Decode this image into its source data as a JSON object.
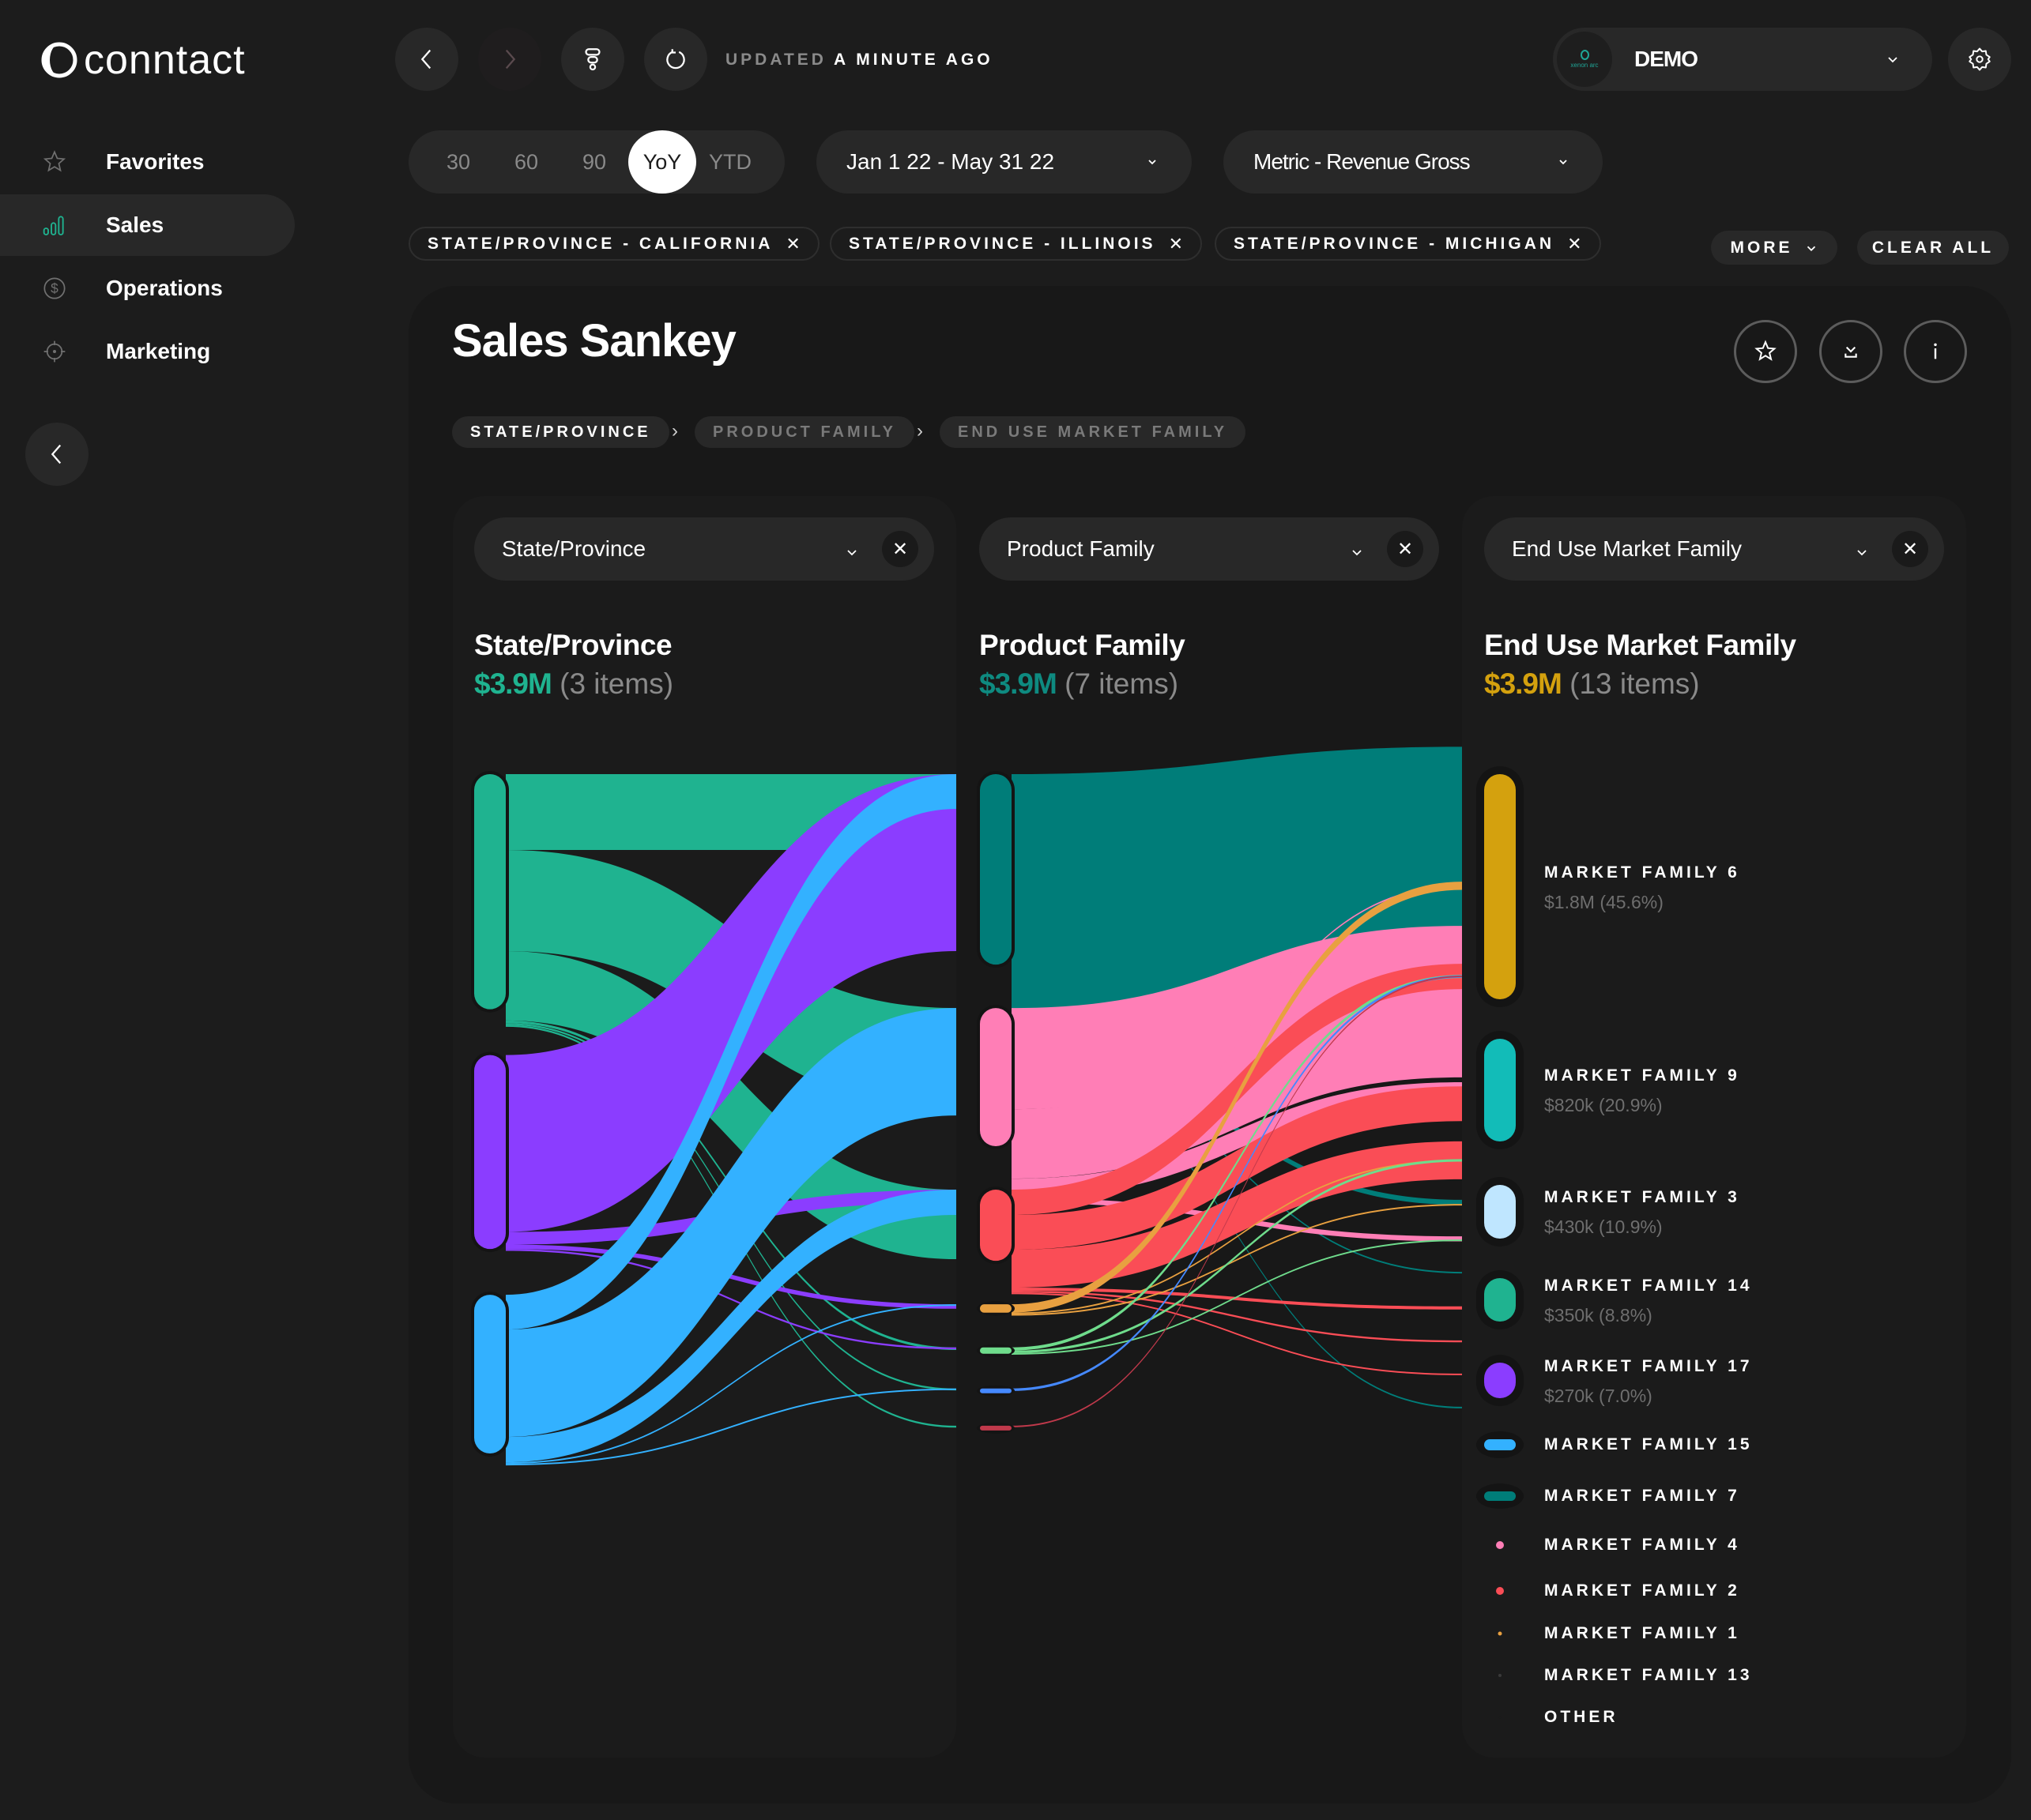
{
  "app": {
    "logo_text": "conntact",
    "updated_prefix": "UPDATED",
    "updated_suffix": "A MINUTE AGO",
    "workspace": {
      "label": "DEMO",
      "brand": "xenon arc"
    }
  },
  "sidebar": {
    "items": [
      {
        "label": "Favorites",
        "icon": "star-icon",
        "active": false
      },
      {
        "label": "Sales",
        "icon": "bar-chart-icon",
        "active": true
      },
      {
        "label": "Operations",
        "icon": "dollar-icon",
        "active": false
      },
      {
        "label": "Marketing",
        "icon": "target-icon",
        "active": false
      }
    ]
  },
  "filters": {
    "periods": [
      "30",
      "60",
      "90",
      "YoY",
      "YTD"
    ],
    "active_period": "YoY",
    "date_range": "Jan 1 22 - May 31 22",
    "metric": "Metric - Revenue Gross",
    "chips": [
      "STATE/PROVINCE - CALIFORNIA",
      "STATE/PROVINCE - ILLINOIS",
      "STATE/PROVINCE - MICHIGAN"
    ],
    "more_label": "MORE",
    "clear_label": "CLEAR ALL"
  },
  "card": {
    "title": "Sales Sankey",
    "breadcrumb": [
      "STATE/PROVINCE",
      "PRODUCT FAMILY",
      "END USE MARKET FAMILY"
    ],
    "columns": [
      {
        "selector": "State/Province",
        "heading": "State/Province",
        "total": "$3.9M",
        "count": "(3 items)",
        "accent": "#1fb390"
      },
      {
        "selector": "Product Family",
        "heading": "Product Family",
        "total": "$3.9M",
        "count": "(7 items)",
        "accent": "#0e8a80"
      },
      {
        "selector": "End Use Market Family",
        "heading": "End Use Market Family",
        "total": "$3.9M",
        "count": "(13 items)",
        "accent": "#d4a10e"
      }
    ]
  },
  "legend": [
    {
      "name": "MARKET FAMILY 6",
      "value": "$1.8M (45.6%)",
      "color": "#d4a10e"
    },
    {
      "name": "MARKET FAMILY 9",
      "value": "$820k (20.9%)",
      "color": "#12bcb8"
    },
    {
      "name": "MARKET FAMILY 3",
      "value": "$430k (10.9%)",
      "color": "#bfe6ff"
    },
    {
      "name": "MARKET FAMILY 14",
      "value": "$350k (8.8%)",
      "color": "#1fb390"
    },
    {
      "name": "MARKET FAMILY 17",
      "value": "$270k (7.0%)",
      "color": "#8b3dff"
    },
    {
      "name": "MARKET FAMILY 15",
      "value": "",
      "color": "#33b1ff"
    },
    {
      "name": "MARKET FAMILY 7",
      "value": "",
      "color": "#007d79"
    },
    {
      "name": "MARKET FAMILY 4",
      "value": "",
      "color": "#ff7eb6"
    },
    {
      "name": "MARKET FAMILY 2",
      "value": "",
      "color": "#fa4d56"
    },
    {
      "name": "MARKET FAMILY 1",
      "value": "",
      "color": "#e8a040"
    },
    {
      "name": "MARKET FAMILY 13",
      "value": "",
      "color": "#3a3a3a"
    },
    {
      "name": "OTHER",
      "value": "",
      "color": "#1b1b1b"
    }
  ],
  "chart_data": {
    "type": "sankey",
    "title": "Sales Sankey",
    "units": "USD",
    "total": 3900000,
    "stages": [
      "State/Province",
      "Product Family",
      "End Use Market Family"
    ],
    "nodes": {
      "state": [
        {
          "id": "s1",
          "share": 0.4,
          "color": "#1fb390"
        },
        {
          "id": "s2",
          "share": 0.33,
          "color": "#8b3dff"
        },
        {
          "id": "s3",
          "share": 0.27,
          "color": "#33b1ff"
        }
      ],
      "product": [
        {
          "id": "p1",
          "share": 0.455,
          "color": "#007d79"
        },
        {
          "id": "p2",
          "share": 0.33,
          "color": "#ff7eb6"
        },
        {
          "id": "p3",
          "share": 0.17,
          "color": "#fa4d56"
        },
        {
          "id": "p4",
          "share": 0.02,
          "color": "#e8a040"
        },
        {
          "id": "p5",
          "share": 0.015,
          "color": "#6fdc8c"
        },
        {
          "id": "p6",
          "share": 0.006,
          "color": "#4589ff"
        },
        {
          "id": "p7",
          "share": 0.004,
          "color": "#c0394b"
        }
      ],
      "market": [
        {
          "id": "MARKET FAMILY 6",
          "share": 0.456
        },
        {
          "id": "MARKET FAMILY 9",
          "share": 0.209
        },
        {
          "id": "MARKET FAMILY 3",
          "share": 0.109
        },
        {
          "id": "MARKET FAMILY 14",
          "share": 0.088
        },
        {
          "id": "MARKET FAMILY 17",
          "share": 0.07
        },
        {
          "id": "MARKET FAMILY 15",
          "share": 0.02
        },
        {
          "id": "MARKET FAMILY 7",
          "share": 0.016
        },
        {
          "id": "MARKET FAMILY 4",
          "share": 0.012
        },
        {
          "id": "MARKET FAMILY 2",
          "share": 0.01
        },
        {
          "id": "MARKET FAMILY 1",
          "share": 0.005
        },
        {
          "id": "MARKET FAMILY 13",
          "share": 0.003
        },
        {
          "id": "OTHER",
          "share": 0.002
        }
      ]
    },
    "links_stage1": [
      {
        "source": "s1",
        "target": "p1",
        "share": 0.12
      },
      {
        "source": "s1",
        "target": "p2",
        "share": 0.16
      },
      {
        "source": "s1",
        "target": "p3",
        "share": 0.11
      },
      {
        "source": "s1",
        "target": "p5",
        "share": 0.004
      },
      {
        "source": "s1",
        "target": "p6",
        "share": 0.003
      },
      {
        "source": "s1",
        "target": "p7",
        "share": 0.003
      },
      {
        "source": "s2",
        "target": "p1",
        "share": 0.28
      },
      {
        "source": "s2",
        "target": "p3",
        "share": 0.02
      },
      {
        "source": "s2",
        "target": "p4",
        "share": 0.007
      },
      {
        "source": "s2",
        "target": "p5",
        "share": 0.003
      },
      {
        "source": "s3",
        "target": "p1",
        "share": 0.055
      },
      {
        "source": "s3",
        "target": "p2",
        "share": 0.17
      },
      {
        "source": "s3",
        "target": "p3",
        "share": 0.04
      },
      {
        "source": "s3",
        "target": "p4",
        "share": 0.002
      },
      {
        "source": "s3",
        "target": "p6",
        "share": 0.002
      }
    ],
    "links_stage2": [
      {
        "source": "p1",
        "target": "MARKET FAMILY 6",
        "share": 0.44
      },
      {
        "source": "p1",
        "target": "MARKET FAMILY 9",
        "share": 0.002
      },
      {
        "source": "p1",
        "target": "MARKET FAMILY 15",
        "share": 0.008
      },
      {
        "source": "p1",
        "target": "MARKET FAMILY 4",
        "share": 0.002
      },
      {
        "source": "p1",
        "target": "OTHER",
        "share": 0.001
      },
      {
        "source": "p2",
        "target": "MARKET FAMILY 9",
        "share": 0.16
      },
      {
        "source": "p2",
        "target": "MARKET FAMILY 3",
        "share": 0.11
      },
      {
        "source": "p2",
        "target": "MARKET FAMILY 14",
        "share": 0.03
      },
      {
        "source": "p2",
        "target": "MARKET FAMILY 7",
        "share": 0.008
      },
      {
        "source": "p2",
        "target": "MARKET FAMILY 6",
        "share": 0.002
      },
      {
        "source": "p3",
        "target": "MARKET FAMILY 9",
        "share": 0.04
      },
      {
        "source": "p3",
        "target": "MARKET FAMILY 14",
        "share": 0.055
      },
      {
        "source": "p3",
        "target": "MARKET FAMILY 17",
        "share": 0.06
      },
      {
        "source": "p3",
        "target": "MARKET FAMILY 2",
        "share": 0.005
      },
      {
        "source": "p3",
        "target": "MARKET FAMILY 1",
        "share": 0.003
      },
      {
        "source": "p3",
        "target": "MARKET FAMILY 13",
        "share": 0.002
      },
      {
        "source": "p4",
        "target": "MARKET FAMILY 6",
        "share": 0.013
      },
      {
        "source": "p4",
        "target": "MARKET FAMILY 17",
        "share": 0.002
      },
      {
        "source": "p4",
        "target": "MARKET FAMILY 15",
        "share": 0.002
      },
      {
        "source": "p5",
        "target": "MARKET FAMILY 9",
        "share": 0.005
      },
      {
        "source": "p5",
        "target": "MARKET FAMILY 17",
        "share": 0.004
      },
      {
        "source": "p5",
        "target": "MARKET FAMILY 7",
        "share": 0.002
      },
      {
        "source": "p6",
        "target": "MARKET FAMILY 9",
        "share": 0.004
      },
      {
        "source": "p7",
        "target": "MARKET FAMILY 9",
        "share": 0.002
      }
    ]
  }
}
